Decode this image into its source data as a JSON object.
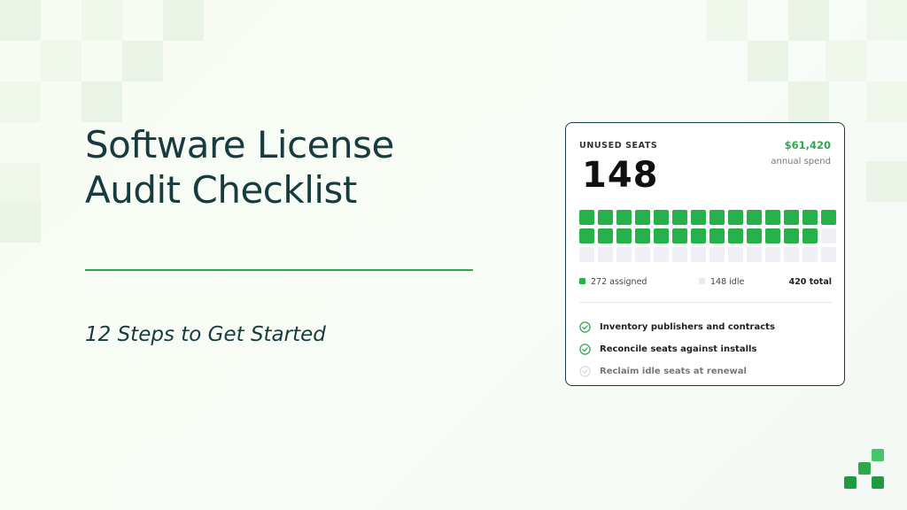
{
  "slide": {
    "title_line1": "Software License",
    "title_line2": "Audit Checklist",
    "subtitle": "12 Steps to Get Started"
  },
  "card": {
    "label": "UNUSED SEATS",
    "unused_seats": "148",
    "spend_value": "$61,420",
    "spend_caption": "annual spend",
    "seat_grid": {
      "assigned_cells": 27,
      "idle_cells": 15,
      "total_cells": 42
    },
    "legend": {
      "assigned": "272 assigned",
      "idle": "148 idle",
      "total": "420 total"
    },
    "checklist": [
      {
        "label": "Inventory publishers and contracts",
        "done": true
      },
      {
        "label": "Reconcile seats against installs",
        "done": true
      },
      {
        "label": "Reclaim idle seats at renewal",
        "done": false
      }
    ]
  },
  "colors": {
    "accent": "#2ea84d",
    "seat_on": "#27b14a",
    "seat_off": "#eef0f6",
    "text_dark": "#173b3f"
  },
  "icons": {
    "check_done": "check-circle-icon",
    "check_pending": "check-circle-outline-icon",
    "brand_logo": "pixel-logo-icon"
  }
}
